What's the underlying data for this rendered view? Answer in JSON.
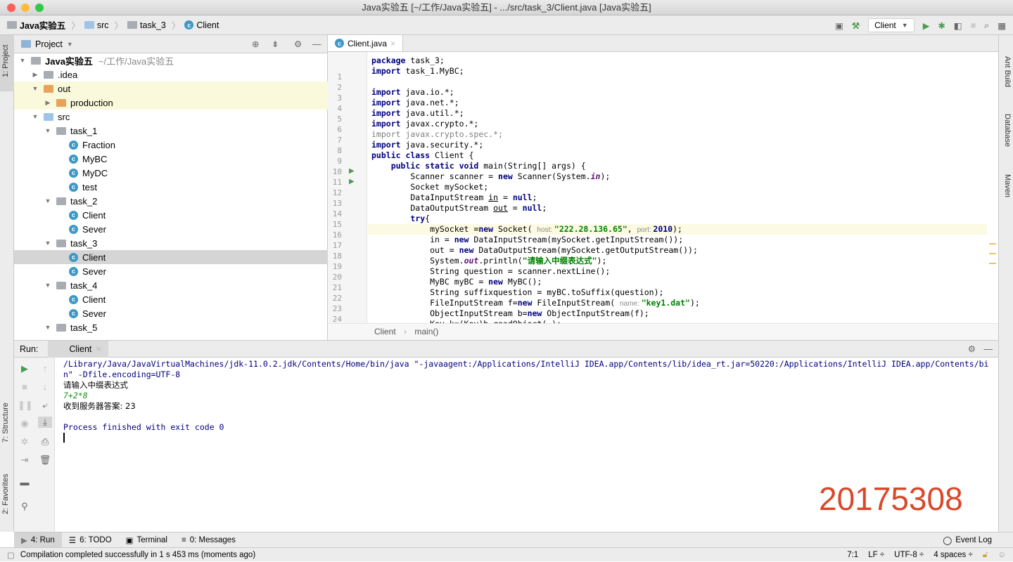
{
  "window": {
    "title": "Java实验五 [~/工作/Java实验五] - .../src/task_3/Client.java [Java实验五]"
  },
  "navbar": {
    "crumbs": [
      "Java实验五",
      "src",
      "task_3",
      "Client"
    ],
    "run_config": "Client"
  },
  "left_stripe": {
    "project": "1: Project",
    "structure": "7: Structure",
    "favorites": "2: Favorites"
  },
  "right_stripe": {
    "ant": "Ant Build",
    "database": "Database",
    "maven": "Maven"
  },
  "project": {
    "title": "Project",
    "tree": [
      {
        "depth": 0,
        "arrow": "▼",
        "icon": "module",
        "label": "Java实验五",
        "extra": "~/工作/Java实验五",
        "bold": true
      },
      {
        "depth": 1,
        "arrow": "▶",
        "icon": "folder-gray",
        "label": ".idea"
      },
      {
        "depth": 1,
        "arrow": "▼",
        "icon": "folder-orange",
        "label": "out",
        "hl": true
      },
      {
        "depth": 2,
        "arrow": "▶",
        "icon": "folder-orange",
        "label": "production",
        "hl": true
      },
      {
        "depth": 1,
        "arrow": "▼",
        "icon": "folder-blue",
        "label": "src"
      },
      {
        "depth": 2,
        "arrow": "▼",
        "icon": "folder-gray",
        "label": "task_1"
      },
      {
        "depth": 3,
        "arrow": "",
        "icon": "class",
        "label": "Fraction"
      },
      {
        "depth": 3,
        "arrow": "",
        "icon": "class",
        "label": "MyBC"
      },
      {
        "depth": 3,
        "arrow": "",
        "icon": "class",
        "label": "MyDC"
      },
      {
        "depth": 3,
        "arrow": "",
        "icon": "class-run",
        "label": "test"
      },
      {
        "depth": 2,
        "arrow": "▼",
        "icon": "folder-gray",
        "label": "task_2"
      },
      {
        "depth": 3,
        "arrow": "",
        "icon": "class-run",
        "label": "Client"
      },
      {
        "depth": 3,
        "arrow": "",
        "icon": "class-run",
        "label": "Sever"
      },
      {
        "depth": 2,
        "arrow": "▼",
        "icon": "folder-gray",
        "label": "task_3"
      },
      {
        "depth": 3,
        "arrow": "",
        "icon": "class-run",
        "label": "Client",
        "selected": true
      },
      {
        "depth": 3,
        "arrow": "",
        "icon": "class-run",
        "label": "Sever"
      },
      {
        "depth": 2,
        "arrow": "▼",
        "icon": "folder-gray",
        "label": "task_4"
      },
      {
        "depth": 3,
        "arrow": "",
        "icon": "class-run",
        "label": "Client"
      },
      {
        "depth": 3,
        "arrow": "",
        "icon": "class-run",
        "label": "Sever"
      },
      {
        "depth": 2,
        "arrow": "▼",
        "icon": "folder-gray",
        "label": "task_5"
      }
    ]
  },
  "editor": {
    "tab": "Client.java",
    "breadcrumb": [
      "Client",
      "main()"
    ],
    "lines": [
      [
        [
          "k",
          "package"
        ],
        [
          "p",
          " task_3;"
        ]
      ],
      [
        [
          "k",
          "import"
        ],
        [
          "p",
          " task_1.MyBC;"
        ]
      ],
      [],
      [
        [
          "k",
          "import"
        ],
        [
          "p",
          " java.io.*;"
        ]
      ],
      [
        [
          "k",
          "import"
        ],
        [
          "p",
          " java.net.*;"
        ]
      ],
      [
        [
          "k",
          "import"
        ],
        [
          "p",
          " java.util.*;"
        ]
      ],
      [
        [
          "k",
          "import"
        ],
        [
          "p",
          " javax.crypto.*;"
        ]
      ],
      [
        [
          "g",
          "import javax.crypto.spec.*;"
        ]
      ],
      [
        [
          "k",
          "import"
        ],
        [
          "p",
          " java.security.*;"
        ]
      ],
      [
        [
          "k",
          "public class"
        ],
        [
          "p",
          " Client {"
        ]
      ],
      [
        [
          "p",
          "    "
        ],
        [
          "k",
          "public static void"
        ],
        [
          "p",
          " main(String[] args) {"
        ]
      ],
      [
        [
          "p",
          "        Scanner scanner = "
        ],
        [
          "k",
          "new"
        ],
        [
          "p",
          " Scanner(System."
        ],
        [
          "f",
          "in"
        ],
        [
          "p",
          ");"
        ]
      ],
      [
        [
          "p",
          "        Socket mySocket;"
        ]
      ],
      [
        [
          "p",
          "        DataInputStream "
        ],
        [
          "u",
          "in"
        ],
        [
          "p",
          " = "
        ],
        [
          "k",
          "null"
        ],
        [
          "p",
          ";"
        ]
      ],
      [
        [
          "p",
          "        DataOutputStream "
        ],
        [
          "u",
          "out"
        ],
        [
          "p",
          " = "
        ],
        [
          "k",
          "null"
        ],
        [
          "p",
          ";"
        ]
      ],
      [
        [
          "p",
          "        "
        ],
        [
          "k",
          "try"
        ],
        [
          "p",
          "{"
        ]
      ],
      [
        [
          "p",
          "            mySocket ="
        ],
        [
          "k",
          "new"
        ],
        [
          "p",
          " Socket( "
        ],
        [
          "h",
          "host: "
        ],
        [
          "s",
          "\"222.28.136.65\""
        ],
        [
          "p",
          ", "
        ],
        [
          "h",
          "port: "
        ],
        [
          "k",
          "2010"
        ],
        [
          "p",
          ");"
        ]
      ],
      [
        [
          "p",
          "            in = "
        ],
        [
          "k",
          "new"
        ],
        [
          "p",
          " DataInputStream(mySocket.getInputStream());"
        ]
      ],
      [
        [
          "p",
          "            out = "
        ],
        [
          "k",
          "new"
        ],
        [
          "p",
          " DataOutputStream(mySocket.getOutputStream());"
        ]
      ],
      [
        [
          "p",
          "            System."
        ],
        [
          "f",
          "out"
        ],
        [
          "p",
          ".println("
        ],
        [
          "s",
          "\"请输入中缀表达式\""
        ],
        [
          "p",
          ");"
        ]
      ],
      [
        [
          "p",
          "            String question = scanner.nextLine();"
        ]
      ],
      [
        [
          "p",
          "            MyBC myBC = "
        ],
        [
          "k",
          "new"
        ],
        [
          "p",
          " MyBC();"
        ]
      ],
      [
        [
          "p",
          "            String suffixquestion = myBC.toSuffix(question);"
        ]
      ],
      [
        [
          "p",
          "            FileInputStream f="
        ],
        [
          "k",
          "new"
        ],
        [
          "p",
          " FileInputStream( "
        ],
        [
          "h",
          "name: "
        ],
        [
          "s",
          "\"key1.dat\""
        ],
        [
          "p",
          ");"
        ]
      ],
      [
        [
          "p",
          "            ObjectInputStream b="
        ],
        [
          "k",
          "new"
        ],
        [
          "p",
          " ObjectInputStream(f);"
        ]
      ],
      [
        [
          "p",
          "            Key k=(Key)b.readObject( );"
        ]
      ]
    ]
  },
  "run": {
    "label": "Run:",
    "tab": "Client",
    "console": [
      {
        "text": "/Library/Java/JavaVirtualMachines/jdk-11.0.2.jdk/Contents/Home/bin/java \"-javaagent:/Applications/IntelliJ IDEA.app/Contents/lib/idea_rt.jar=50220:/Applications/IntelliJ IDEA.app/Contents/bin\" -Dfile.encoding=UTF-8",
        "color": "#000080"
      },
      {
        "text": "请输入中缀表达式",
        "color": "#000000"
      },
      {
        "text": "7+2*8",
        "color": "#1c8c1c",
        "italic": true
      },
      {
        "text": "收到服务器答案: 23",
        "color": "#000000"
      },
      {
        "text": "",
        "color": "#000"
      },
      {
        "text": "Process finished with exit code 0",
        "color": "#000080"
      }
    ]
  },
  "watermark": "20175308",
  "bottom_tabs": [
    "4: Run",
    "6: TODO",
    "Terminal",
    "0: Messages"
  ],
  "event_log": "Event Log",
  "status": {
    "message": "Compilation completed successfully in 1 s 453 ms (moments ago)",
    "position": "7:1",
    "line_sep": "LF ÷",
    "encoding": "UTF-8 ÷",
    "indent": "4 spaces ÷"
  },
  "colors": {
    "keyword": "#000080",
    "string": "#008000",
    "watermark": "#d9482b",
    "run_green": "#499c54"
  }
}
